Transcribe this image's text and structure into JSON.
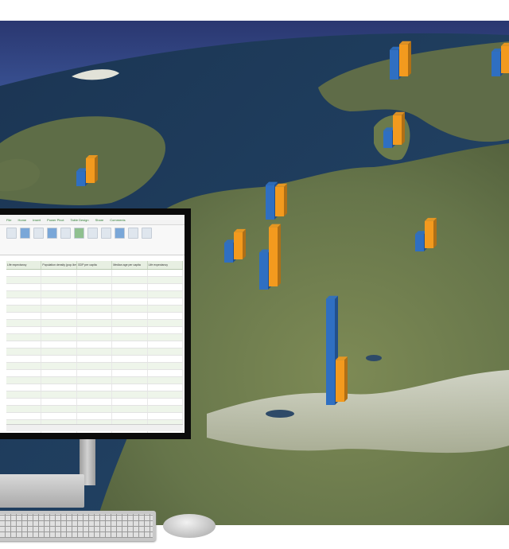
{
  "map": {
    "theme": "satellite-3d-globe",
    "region": "Western Europe",
    "colors": {
      "series_a": "#2f6fc2",
      "series_b": "#f39a1e",
      "ocean": "#1e3a5c",
      "land": "#6e7c4e",
      "sky": "#2b3a79"
    },
    "bar_groups": [
      {
        "id": "norway",
        "a": 0.12,
        "b": 0.13
      },
      {
        "id": "sweden",
        "a": 0.1,
        "b": 0.11
      },
      {
        "id": "denmark",
        "a": 0.07,
        "b": 0.12
      },
      {
        "id": "ireland",
        "a": 0.06,
        "b": 0.1
      },
      {
        "id": "netherlands",
        "a": 0.14,
        "b": 0.12
      },
      {
        "id": "belgium",
        "a": 0.08,
        "b": 0.11
      },
      {
        "id": "luxembourg",
        "a": 0.15,
        "b": 0.24
      },
      {
        "id": "germany",
        "a": 0.07,
        "b": 0.11
      },
      {
        "id": "switzerland",
        "a": 0.43,
        "b": 0.17
      }
    ]
  },
  "spreadsheet": {
    "tabs": [
      "File",
      "Home",
      "Insert",
      "Power Pivot",
      "Table Design",
      "Share",
      "Comments"
    ],
    "columns": [
      "Life expectancy",
      "Population density (pop./km2)",
      "GDP per capita",
      "Median age per capita",
      "Life expectancy"
    ],
    "row_count": 28
  },
  "devices": {
    "monitor": "monitor",
    "keyboard": "keyboard",
    "mouse": "mouse"
  }
}
